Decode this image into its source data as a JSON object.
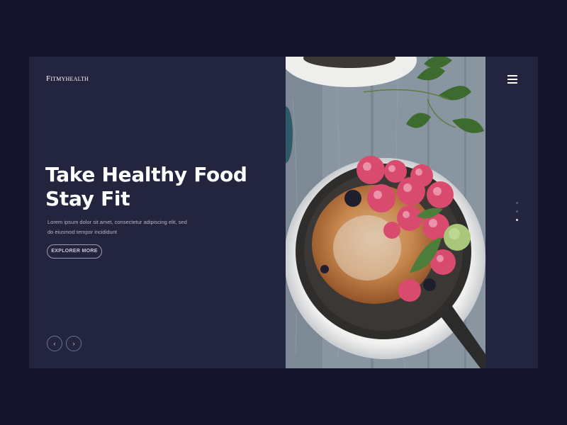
{
  "brand": {
    "logo": "Fitmyhealth"
  },
  "hero": {
    "title_line1": "Take Healthy Food",
    "title_line2": "Stay Fit",
    "description_line1": "Lorem ipsum dolor sit amet, consectetur adipiscing elit, sed",
    "description_line2": "do eiusmod tempor incididunt",
    "cta_label": "EXPLORER MORE"
  },
  "carousel": {
    "prev_icon": "chevron-left-icon",
    "next_icon": "chevron-right-icon",
    "prev_glyph": "‹",
    "next_glyph": "›",
    "slide_count": 3,
    "active_slide": 3
  },
  "image": {
    "subject": "cast iron skillet with baked pancake, raspberries and blueberries on a wooden table"
  },
  "menu": {
    "icon": "hamburger-menu-icon"
  },
  "colors": {
    "page_background": "#14152b",
    "card_background": "#23243e",
    "text_primary": "#ffffff",
    "text_secondary": "#b4b6c9",
    "dot_inactive": "#55577a",
    "dot_active": "#e8e9f2"
  }
}
